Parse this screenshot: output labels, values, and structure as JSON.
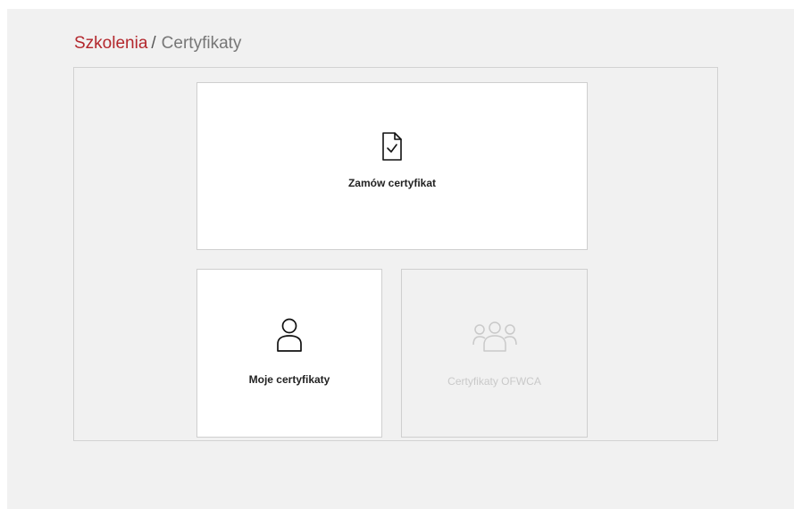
{
  "breadcrumb": {
    "root": "Szkolenia",
    "separator": "/",
    "current": "Certyfikaty"
  },
  "tiles": [
    {
      "label": "Zamów certyfikat",
      "icon": "document-check-icon",
      "disabled": false
    },
    {
      "label": "Moje certyfikaty",
      "icon": "user-icon",
      "disabled": false
    },
    {
      "label": "Certyfikaty OFWCA",
      "icon": "users-group-icon",
      "disabled": true
    }
  ],
  "colors": {
    "accent": "#b3272d",
    "background": "#f1f1f1",
    "tile": "#ffffff",
    "disabled_text": "#c9c9c9"
  }
}
